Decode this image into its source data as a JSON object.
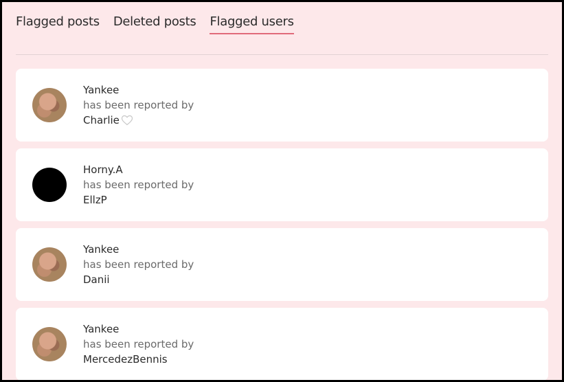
{
  "tabs": [
    {
      "label": "Flagged posts",
      "active": false
    },
    {
      "label": "Deleted posts",
      "active": false
    },
    {
      "label": "Flagged users",
      "active": true
    }
  ],
  "reports": [
    {
      "user": "Yankee",
      "text": "has been reported by",
      "reporter": "Charlie",
      "avatar": "photo",
      "icon": "heart-outline-icon"
    },
    {
      "user": "Horny.A",
      "text": "has been reported by",
      "reporter": "EllzP",
      "avatar": "blank"
    },
    {
      "user": "Yankee",
      "text": "has been reported by",
      "reporter": "Danii",
      "avatar": "photo"
    },
    {
      "user": "Yankee",
      "text": "has been reported by",
      "reporter": "MercedezBennis",
      "avatar": "photo"
    }
  ],
  "colors": {
    "background": "#fde8ea",
    "accent": "#e06a7a",
    "card": "#ffffff"
  }
}
